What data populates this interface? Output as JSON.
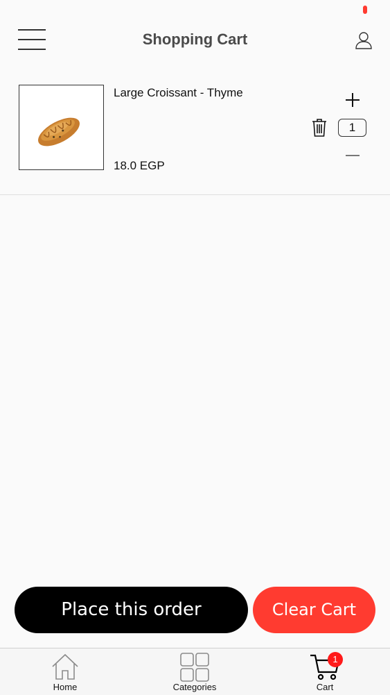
{
  "header": {
    "title": "Shopping Cart",
    "menu_icon": "hamburger-icon",
    "user_icon": "user-icon"
  },
  "cart": {
    "items": [
      {
        "name": "Large Croissant - Thyme",
        "price": "18.0 EGP",
        "quantity": "1",
        "image": "croissant-image"
      }
    ]
  },
  "actions": {
    "place_order_label": "Place this order",
    "clear_cart_label": "Clear Cart"
  },
  "tabbar": {
    "tabs": [
      {
        "label": "Home",
        "icon": "home-icon"
      },
      {
        "label": "Categories",
        "icon": "grid-icon"
      },
      {
        "label": "Cart",
        "icon": "cart-icon"
      }
    ],
    "cart_badge": "1"
  },
  "colors": {
    "accent_red": "#ff3b30",
    "primary_black": "#000000",
    "badge_red": "#ff1a1a"
  }
}
